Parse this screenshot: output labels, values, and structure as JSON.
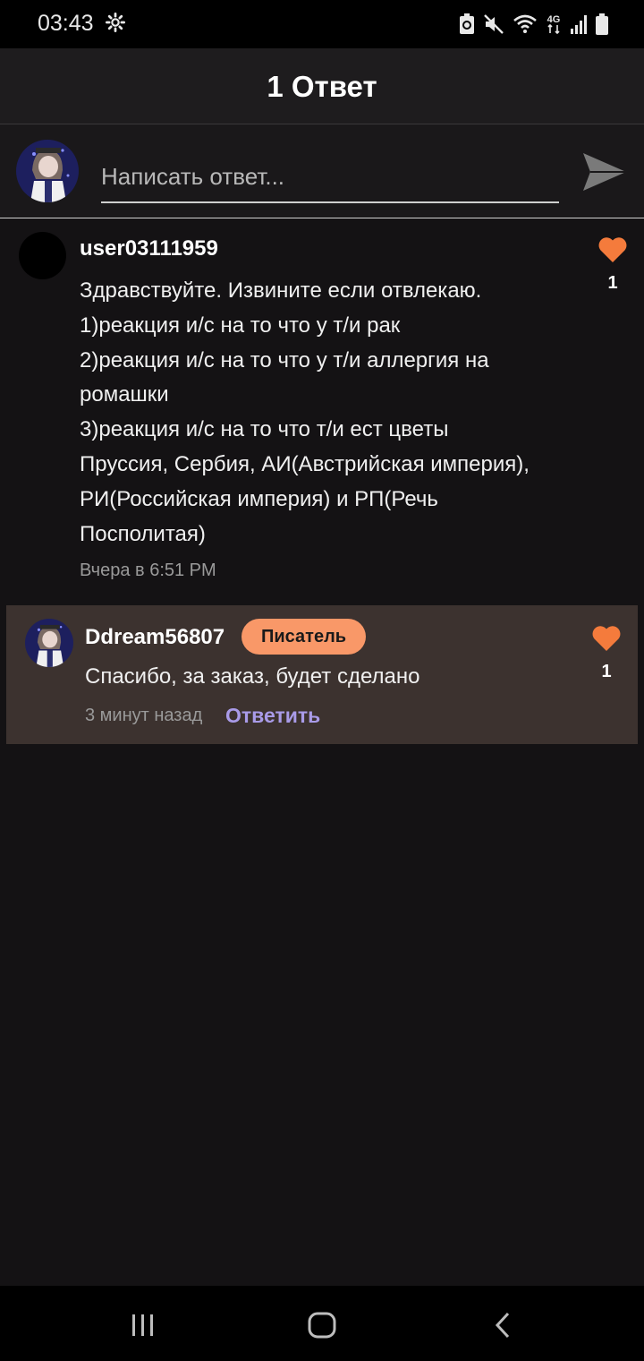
{
  "status_bar": {
    "time": "03:43",
    "network": "4G"
  },
  "header": {
    "title": "1 Ответ"
  },
  "reply_bar": {
    "placeholder": "Написать ответ..."
  },
  "comment": {
    "username": "user03111959",
    "lines": [
      "Здравствуйте. Извините если отвлекаю.",
      "1)реакция и/с на то что у т/и рак",
      "2)реакция и/с на то что у т/и аллергия на",
      "ромашки",
      "3)реакция и/с на то что т/и ест цветы",
      "Пруссия, Сербия, АИ(Австрийская империя),",
      "РИ(Российская империя) и РП(Речь",
      "Посполитая)"
    ],
    "timestamp": "Вчера в 6:51 PM",
    "likes": "1"
  },
  "reply": {
    "username": "Ddream56807",
    "badge": "Писатель",
    "text": "Спасибо, за заказ, будет сделано",
    "timestamp": "3 минут назад",
    "reply_label": "Ответить",
    "likes": "1"
  },
  "colors": {
    "accent": "#f47b3c",
    "badge": "#f99868",
    "link": "#a99be8",
    "reply_bg": "#3c322f"
  }
}
